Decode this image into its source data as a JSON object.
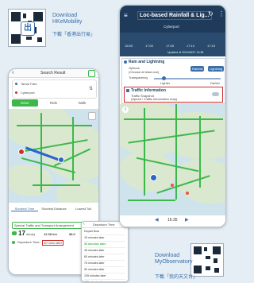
{
  "hkemobility": {
    "title_en": "Download",
    "title_en2": "HKeMobility",
    "download_zh": "下載「香港出行易」"
  },
  "myobservatory": {
    "title_en": "Download",
    "title_en2": "MyObservatory",
    "download_zh": "下載「我的天文台」"
  },
  "left_phone": {
    "header": "Search Result",
    "from": "Tamar Park",
    "to": "Cyberport",
    "modes": [
      "Drive",
      "Ride",
      "Walk"
    ],
    "tabs": [
      "Shortest Time",
      "Shortest Distance",
      "Lowest Toll"
    ],
    "special_label": "Special Traffic and Transport Arrangement",
    "duration": "17",
    "duration_unit": "min(s)",
    "distance": "12.38 km",
    "toll": "$8.0",
    "depart_label": "Departure Time:",
    "depart_value": "30 mins later"
  },
  "right_phone": {
    "title": "Loc-based Rainfall & Lig...",
    "location": "Cyberport",
    "times": [
      "16:55",
      "17:00",
      "17:05",
      "17:10",
      "17:15"
    ],
    "updated": "Updated at 2024/08/27 16:38",
    "section_rain": "Rain and Lightning",
    "options_label": "Options",
    "options_sub": "(Choose at least one)",
    "option_rainfall": "Rainfall",
    "option_lightning": "Lightning",
    "transparency": "Transparency",
    "lighter": "Lighter",
    "darker": "Darker",
    "section_traffic": "Traffic Information",
    "traffic_snapshot": "Traffic Snapshot",
    "traffic_snapshot_sub": "(Speed / Traffic information map)",
    "play_time": "16:35"
  },
  "departure_popup": {
    "title": "Departure Time",
    "options": [
      "Depart Now",
      "15 minutes later",
      "30 minutes later",
      "45 minutes later",
      "60 minutes later",
      "75 minutes later",
      "90 minutes later",
      "105 minutes later",
      "120 minutes later"
    ],
    "selected": "30 minutes later"
  },
  "colors": {
    "accent_blue": "#3a6ea8",
    "route_green": "#3cb84a",
    "header_dark": "#1f3b5c",
    "alert_red": "#c9302c"
  }
}
